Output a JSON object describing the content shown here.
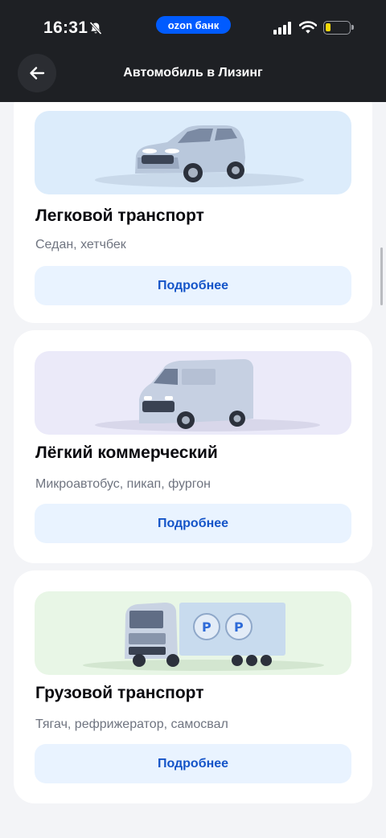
{
  "status_bar": {
    "time": "16:31",
    "bank_label": "ozon банк",
    "icons": [
      "bell-muted-icon",
      "signal-icon",
      "wifi-icon",
      "battery-icon"
    ]
  },
  "header": {
    "title": "Автомобиль в Лизинг",
    "back_icon": "arrow-left-icon"
  },
  "cards": [
    {
      "title": "Легковой транспорт",
      "subtitle": "Седан, хетчбек",
      "button": "Подробнее",
      "image": "suv-car-image",
      "image_bg": "#dcecfb"
    },
    {
      "title": "Лёгкий коммерческий",
      "subtitle": "Микроавтобус, пикап, фургон",
      "button": "Подробнее",
      "image": "van-image",
      "image_bg": "#ebeaf9"
    },
    {
      "title": "Грузовой транспорт",
      "subtitle": "Тягач, рефрижератор, самосвал",
      "button": "Подробнее",
      "image": "truck-image",
      "image_bg": "#e8f6e6"
    }
  ],
  "colors": {
    "accent": "#005bff",
    "button_bg": "#e9f3ff",
    "button_text": "#1454c8",
    "header_bg": "#1e2024",
    "page_bg": "#f3f4f7"
  }
}
